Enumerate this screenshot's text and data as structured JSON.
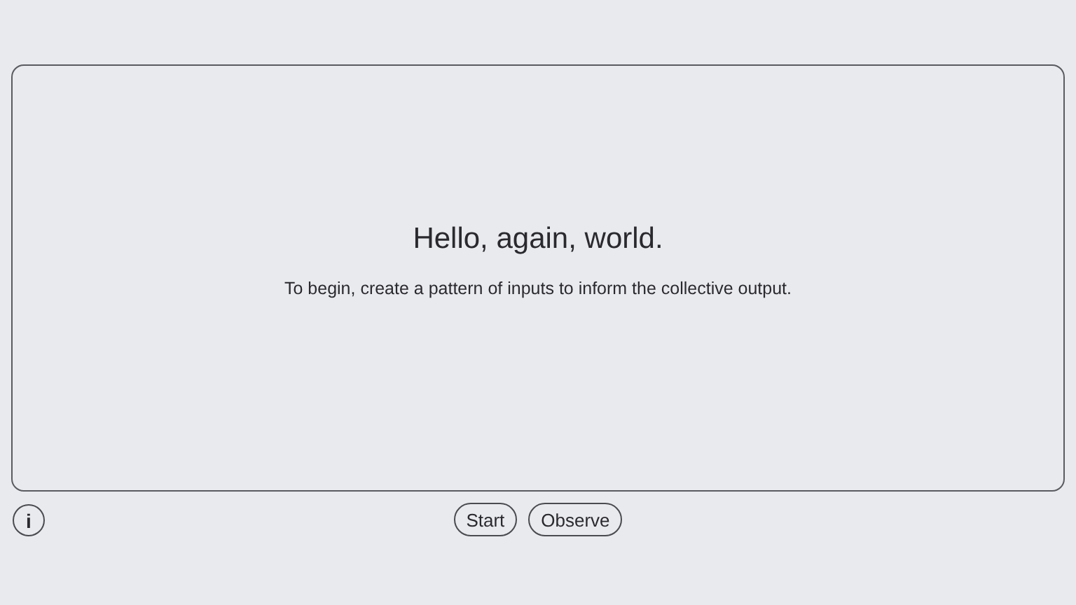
{
  "panel": {
    "title": "Hello, again, world.",
    "message": "To begin, create a pattern of inputs to inform the collective output."
  },
  "info_button": {
    "label": "i"
  },
  "buttons": [
    "Start",
    "Observe"
  ]
}
